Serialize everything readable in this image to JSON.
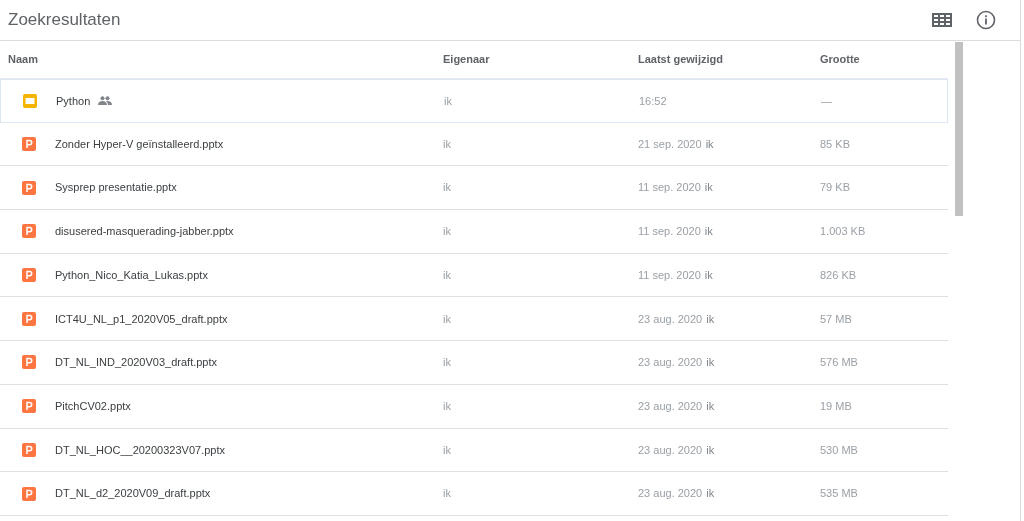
{
  "title": "Zoekresultaten",
  "columns": [
    "Naam",
    "Eigenaar",
    "Laatst gewijzigd",
    "Grootte"
  ],
  "rows": [
    {
      "kind": "slides",
      "name": "Python",
      "shared": true,
      "owner": "ik",
      "modified": "16:52",
      "size": "—",
      "selected": true
    },
    {
      "kind": "pptx",
      "name": "Zonder Hyper-V geïnstalleerd.pptx",
      "shared": false,
      "owner": "ik",
      "modified": "21 sep. 2020",
      "modified_by": "ik",
      "size": "85 KB",
      "selected": false
    },
    {
      "kind": "pptx",
      "name": "Sysprep presentatie.pptx",
      "shared": false,
      "owner": "ik",
      "modified": "11 sep. 2020",
      "modified_by": "ik",
      "size": "79 KB",
      "selected": false
    },
    {
      "kind": "pptx",
      "name": "disusered-masquerading-jabber.pptx",
      "shared": false,
      "owner": "ik",
      "modified": "11 sep. 2020",
      "modified_by": "ik",
      "size": "1.003 KB",
      "selected": false
    },
    {
      "kind": "pptx",
      "name": "Python_Nico_Katia_Lukas.pptx",
      "shared": false,
      "owner": "ik",
      "modified": "11 sep. 2020",
      "modified_by": "ik",
      "size": "826 KB",
      "selected": false
    },
    {
      "kind": "pptx",
      "name": "ICT4U_NL_p1_2020V05_draft.pptx",
      "shared": false,
      "owner": "ik",
      "modified": "23 aug. 2020",
      "modified_by": "ik",
      "size": "57 MB",
      "selected": false
    },
    {
      "kind": "pptx",
      "name": "DT_NL_IND_2020V03_draft.pptx",
      "shared": false,
      "owner": "ik",
      "modified": "23 aug. 2020",
      "modified_by": "ik",
      "size": "576 MB",
      "selected": false
    },
    {
      "kind": "pptx",
      "name": "PitchCV02.pptx",
      "shared": false,
      "owner": "ik",
      "modified": "23 aug. 2020",
      "modified_by": "ik",
      "size": "19 MB",
      "selected": false
    },
    {
      "kind": "pptx",
      "name": "DT_NL_HOC__20200323V07.pptx",
      "shared": false,
      "owner": "ik",
      "modified": "23 aug. 2020",
      "modified_by": "ik",
      "size": "530 MB",
      "selected": false
    },
    {
      "kind": "pptx",
      "name": "DT_NL_d2_2020V09_draft.pptx",
      "shared": false,
      "owner": "ik",
      "modified": "23 aug. 2020",
      "modified_by": "ik",
      "size": "535 MB",
      "selected": false
    }
  ]
}
